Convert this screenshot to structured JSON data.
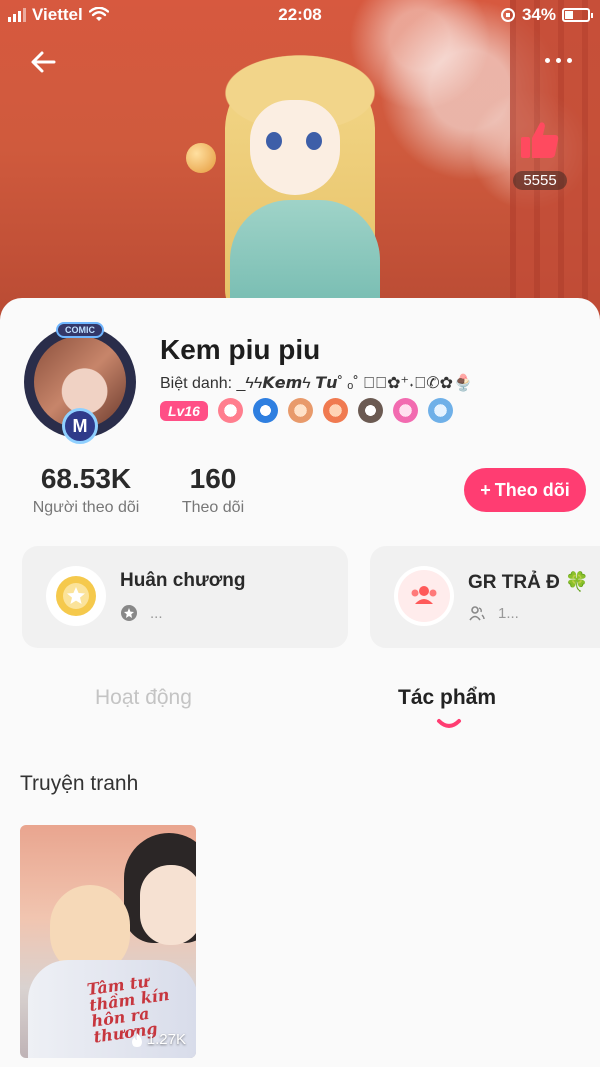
{
  "status_bar": {
    "carrier": "Viettel",
    "time": "22:08",
    "battery": "34%"
  },
  "header": {
    "likes": "5555"
  },
  "profile": {
    "name": "Kem piu piu",
    "nickname_label": "Biệt danh:",
    "nickname_value": "_ϟϟ𝙆𝙚𝙢ϟ 𝙏𝙪˚ ₒ˚ 𝙞⃠✿⁺˖⌕✆✿🍨",
    "level": "Lv16",
    "avatar_top_label": "COMIC",
    "avatar_badge_letter": "M"
  },
  "stats": {
    "followers_value": "68.53K",
    "followers_label": "Người theo dõi",
    "following_value": "160",
    "following_label": "Theo dõi"
  },
  "follow_button": {
    "plus": "+",
    "label": "Theo dõi"
  },
  "tiles": [
    {
      "title": "Huân chương",
      "sub": "..."
    },
    {
      "title": "GR TRẢ Đ 🍀",
      "sub": "1..."
    }
  ],
  "tabs": [
    {
      "label": "Hoạt động",
      "active": false
    },
    {
      "label": "Tác phẩm",
      "active": true
    }
  ],
  "section": {
    "title": "Truyện tranh"
  },
  "works": [
    {
      "cover_title": "Tâm tư thầm kín hôn ra thương",
      "views": "1.27K"
    }
  ],
  "colors": {
    "accent": "#ff3d72",
    "level_badge": "#ff4f86",
    "banner": "#d7593f",
    "like_thumb": "#ff4a5f"
  }
}
